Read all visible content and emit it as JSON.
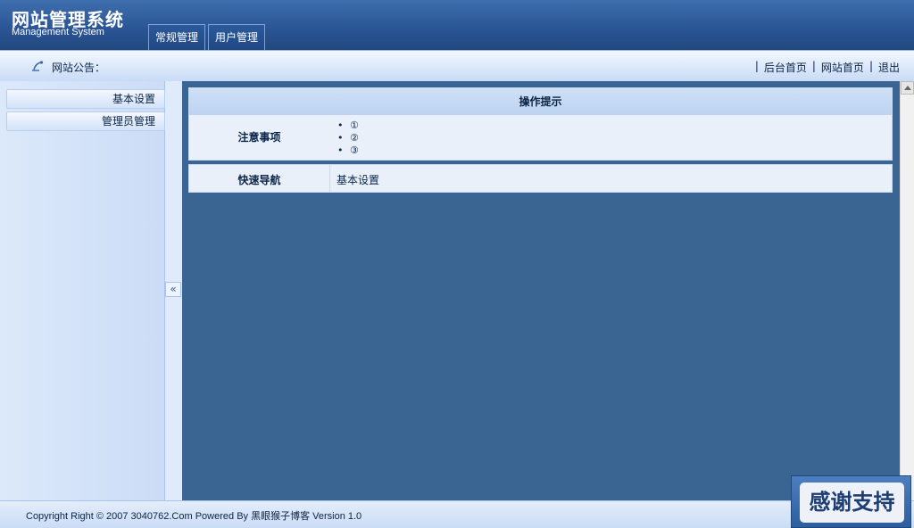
{
  "header": {
    "title": "网站管理系统",
    "subtitle": "Management System",
    "tabs": [
      {
        "label": "常规管理"
      },
      {
        "label": "用户管理"
      }
    ]
  },
  "noticebar": {
    "label": "网站公告：",
    "links": [
      {
        "label": "后台首页"
      },
      {
        "label": "网站首页"
      },
      {
        "label": "退出"
      }
    ],
    "separator": "|"
  },
  "sidebar": {
    "items": [
      {
        "label": "基本设置"
      },
      {
        "label": "管理员管理"
      }
    ],
    "toggle_label": "«"
  },
  "main": {
    "tips_title": "操作提示",
    "notes_label": "注意事项",
    "notes": [
      "①",
      "②",
      "③"
    ],
    "quicknav_label": "快速导航",
    "quicknav_link": "基本设置"
  },
  "footer": {
    "copyright": "Copyright Right © 2007 3040762.Com Powered By 黑眼猴子博客  Version 1.0"
  },
  "badge": {
    "text": "感谢支持"
  },
  "colors": {
    "header_bg": "#2a5493",
    "main_bg": "#3a6593",
    "panel_bg": "#e9f0fa",
    "text": "#0b2546"
  }
}
